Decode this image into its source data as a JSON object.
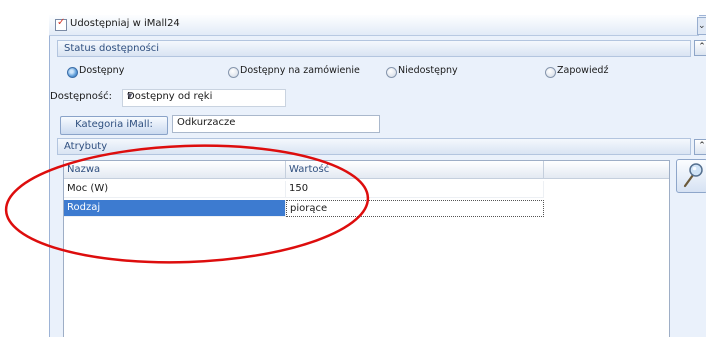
{
  "header": {
    "share_label": "Udostępniaj w iMall24",
    "share_checked": true,
    "corner_button": "⌄"
  },
  "status_section": {
    "title": "Status dostępności",
    "options": [
      "Dostępny",
      "Dostępny na zamówienie",
      "Niedostępny",
      "Zapowiedź"
    ],
    "selected": "Dostępny",
    "collapse_glyph": "⌃"
  },
  "availability": {
    "label": "Dostępność:",
    "value": "Dostępny od ręki"
  },
  "category": {
    "button_label": "Kategoria iMall:",
    "value": "Odkurzacze"
  },
  "attributes": {
    "title": "Atrybuty",
    "collapse_glyph": "⌃",
    "columns": [
      "Nazwa",
      "Wartość"
    ],
    "rows": [
      {
        "name": "Moc (W)",
        "value": "150"
      },
      {
        "name": "Rodzaj",
        "value": "piorące"
      }
    ],
    "selected_row": 1
  },
  "colors": {
    "annotation": "#dd0d0d",
    "selection": "#3d7bd0",
    "header_text": "#2f4f7f"
  },
  "icons": {
    "side_button": "magnifier-icon"
  }
}
